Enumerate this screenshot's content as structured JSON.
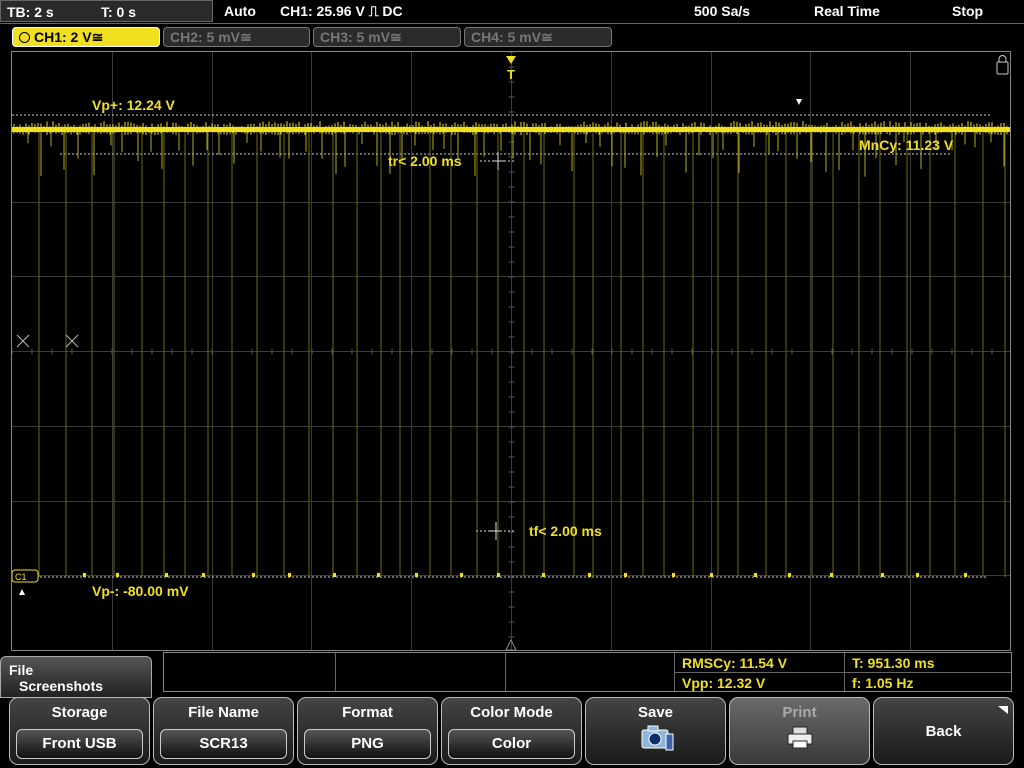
{
  "status": {
    "timebase": "TB: 2 s",
    "trigger_time": "T: 0 s",
    "trigger_mode": "Auto",
    "trigger_info": "CH1: 25.96 V ⎍ DC",
    "sample_rate": "500 Sa/s",
    "acq_mode": "Real Time",
    "run_state": "Stop"
  },
  "channels": [
    {
      "label": "CH1: 2 V≅",
      "active": true
    },
    {
      "label": "CH2: 5 mV≅",
      "active": false
    },
    {
      "label": "CH3: 5 mV≅",
      "active": false
    },
    {
      "label": "CH4: 5 mV≅",
      "active": false
    }
  ],
  "waveform": {
    "trigger_marker": "T",
    "ch_marker": "C1",
    "vp_plus": "Vp+: 12.24 V",
    "vp_minus": "Vp-: -80.00 mV",
    "rise": "tr< 2.00 ms",
    "fall": "tf< 2.00 ms",
    "mncy": "MnCy: 11.23 V",
    "trace_color": "#f0e020"
  },
  "measurements": {
    "rmscy": "RMSCy: 11.54 V",
    "vpp": "Vpp: 12.32 V",
    "period": "T: 951.30 ms",
    "freq": "f: 1.05 Hz"
  },
  "menu": {
    "title_line1": "File",
    "title_line2": "Screenshots"
  },
  "softkeys": [
    {
      "title": "Storage",
      "value": "Front USB"
    },
    {
      "title": "File Name",
      "value": "SCR13"
    },
    {
      "title": "Format",
      "value": "PNG"
    },
    {
      "title": "Color Mode",
      "value": "Color"
    },
    {
      "title": "Save",
      "icon": "camera-save-icon"
    },
    {
      "title": "Print",
      "icon": "printer-icon"
    },
    {
      "title": "Back"
    }
  ]
}
